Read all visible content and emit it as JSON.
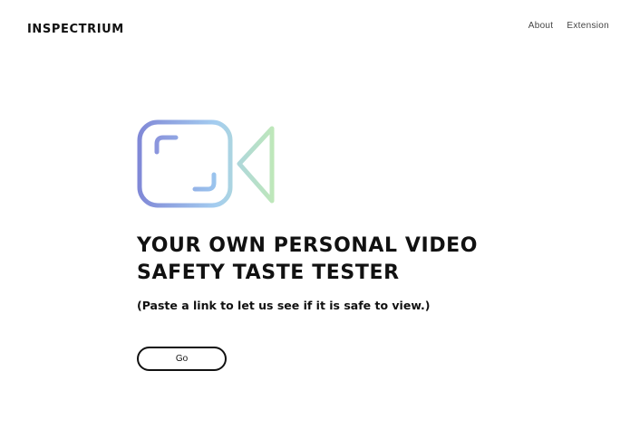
{
  "header": {
    "logo_text": "INSPECTRIUM",
    "nav": [
      {
        "label": "About"
      },
      {
        "label": "Extension"
      }
    ]
  },
  "hero": {
    "icon": "video-camera-icon",
    "headline_line1": "YOUR OWN PERSONAL VIDEO",
    "headline_line2": "SAFETY TASTE TESTER",
    "subtext": "(Paste a link to let us see if it is safe to view.)",
    "button_label": "Go"
  },
  "colors": {
    "text": "#111111",
    "gradient_start": "#7f86d6",
    "gradient_mid": "#9fc8ee",
    "gradient_end": "#bfeab0"
  }
}
